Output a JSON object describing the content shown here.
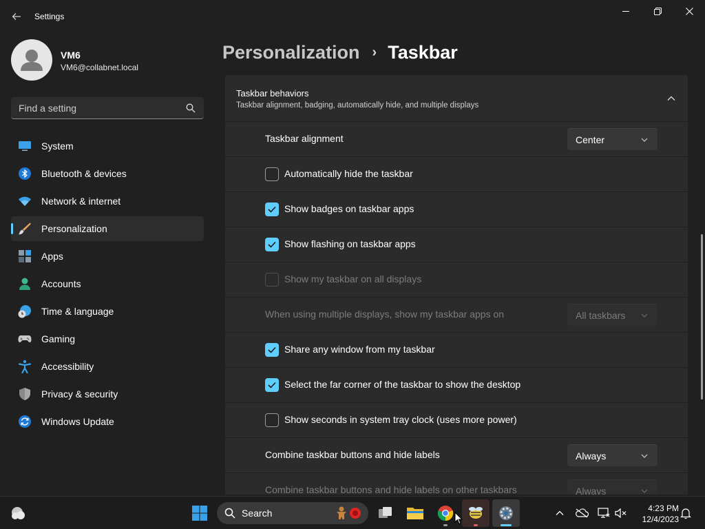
{
  "window": {
    "title": "Settings"
  },
  "user": {
    "name": "VM6",
    "email": "VM6@collabnet.local"
  },
  "search": {
    "placeholder": "Find a setting"
  },
  "sidebar": {
    "items": [
      {
        "label": "System",
        "icon": "system-icon"
      },
      {
        "label": "Bluetooth & devices",
        "icon": "bluetooth-icon"
      },
      {
        "label": "Network & internet",
        "icon": "wifi-icon"
      },
      {
        "label": "Personalization",
        "icon": "brush-icon",
        "active": true
      },
      {
        "label": "Apps",
        "icon": "apps-icon"
      },
      {
        "label": "Accounts",
        "icon": "person-icon"
      },
      {
        "label": "Time & language",
        "icon": "globe-clock-icon"
      },
      {
        "label": "Gaming",
        "icon": "controller-icon"
      },
      {
        "label": "Accessibility",
        "icon": "accessibility-icon"
      },
      {
        "label": "Privacy & security",
        "icon": "shield-icon"
      },
      {
        "label": "Windows Update",
        "icon": "update-icon"
      }
    ]
  },
  "breadcrumb": {
    "parent": "Personalization",
    "separator": "›",
    "current": "Taskbar"
  },
  "section": {
    "title": "Taskbar behaviors",
    "description": "Taskbar alignment, badging, automatically hide, and multiple displays",
    "expanded": true
  },
  "settings": [
    {
      "type": "dropdown",
      "label": "Taskbar alignment",
      "value": "Center",
      "disabled": false
    },
    {
      "type": "checkbox",
      "label": "Automatically hide the taskbar",
      "checked": false,
      "disabled": false
    },
    {
      "type": "checkbox",
      "label": "Show badges on taskbar apps",
      "checked": true,
      "disabled": false
    },
    {
      "type": "checkbox",
      "label": "Show flashing on taskbar apps",
      "checked": true,
      "disabled": false
    },
    {
      "type": "checkbox",
      "label": "Show my taskbar on all displays",
      "checked": false,
      "disabled": true
    },
    {
      "type": "dropdown",
      "label": "When using multiple displays, show my taskbar apps on",
      "value": "All taskbars",
      "disabled": true
    },
    {
      "type": "checkbox",
      "label": "Share any window from my taskbar",
      "checked": true,
      "disabled": false
    },
    {
      "type": "checkbox",
      "label": "Select the far corner of the taskbar to show the desktop",
      "checked": true,
      "disabled": false
    },
    {
      "type": "checkbox",
      "label": "Show seconds in system tray clock (uses more power)",
      "checked": false,
      "disabled": false
    },
    {
      "type": "dropdown",
      "label": "Combine taskbar buttons and hide labels",
      "value": "Always",
      "disabled": false
    },
    {
      "type": "dropdown",
      "label": "Combine taskbar buttons and hide labels on other taskbars",
      "value": "Always",
      "disabled": true
    }
  ],
  "taskbar": {
    "search_label": "Search",
    "apps": [
      "start-icon",
      "search-icon",
      "task-view-icon",
      "file-explorer-icon",
      "chrome-icon",
      "app-icon",
      "settings-icon"
    ],
    "time": "4:23 PM",
    "date": "12/4/2023"
  },
  "colors": {
    "accent": "#60cdff",
    "background": "#202020",
    "card": "#2b2b2b"
  }
}
